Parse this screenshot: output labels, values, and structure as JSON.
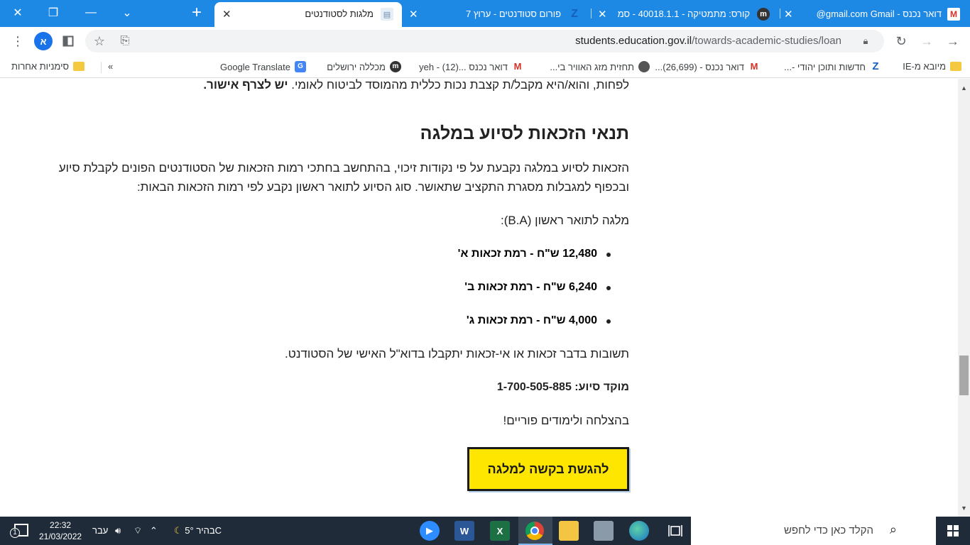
{
  "browser": {
    "tabs": [
      {
        "title": "דואר נכנס - Gmail ‏gmail.com@",
        "icon": "gmail-icon"
      },
      {
        "title": "קורס: מתמטיקה - 40018.1.1 - סמ",
        "icon": "moodle-icon"
      },
      {
        "title": "פורום סטודנטים - ערוץ 7",
        "icon": "arutz7-icon"
      },
      {
        "title": "מלגות לסטודנטים",
        "icon": "page-icon"
      }
    ],
    "new_tab": "+",
    "url_host": "students.education.gov.il",
    "url_path": "/towards-academic-studies/loan",
    "profile_initial": "א"
  },
  "bookmarks": {
    "items": [
      {
        "label": "מיובא מ-IE",
        "icon": "folder-icon"
      },
      {
        "label": "חדשות ותוכן יהודי -...",
        "icon": "arutz7-icon"
      },
      {
        "label": "דואר נכנס - (26,699)...",
        "icon": "gmail-icon"
      },
      {
        "label": "תחזית מזג האוויר בי...",
        "icon": "globe-icon"
      },
      {
        "label": "דואר נכנס ...yeh - (12)",
        "icon": "gmail-icon"
      },
      {
        "label": "מכללה ירושלים",
        "icon": "moodle-icon"
      },
      {
        "label": "Google Translate",
        "icon": "translate-icon"
      }
    ],
    "more": "»",
    "other": "סימניות אחרות"
  },
  "page": {
    "top_fragment": "לפחות, והוא/היא מקבל/ת קצבת נכות כללית מהמוסד לביטוח לאומי.",
    "top_fragment_bold": "יש לצרף אישור.",
    "heading": "תנאי הזכאות לסיוע במלגה",
    "intro_line1": "הזכאות לסיוע במלגה נקבעת על פי נקודות זיכוי, בהתחשב בחתכי רמות הזכאות של הסטודנטים הפונים לקבלת סיוע",
    "intro_line2": "ובכפוף למגבלות מסגרת התקציב שתאושר. סוג הסיוע לתואר ראשון נקבע לפי רמות הזכאות הבאות:",
    "ba_label": "מלגה לתואר ראשון (B.A):",
    "levels": [
      "12,480 ש\"ח - רמת זכאות א'",
      "6,240 ש\"ח - רמת זכאות ב'",
      "4,000 ש\"ח - רמת זכאות ג'"
    ],
    "answers_note": "תשובות בדבר זכאות או אי-זכאות יתקבלו בדוא\"ל האישי של הסטודנט.",
    "support_line": "מוקד סיוע: 1-700-505-885",
    "good_luck": "בהצלחה ולימודים פוריים!",
    "apply_button": "להגשת בקשה למלגה"
  },
  "taskbar": {
    "search_placeholder": "הקלד כאן כדי לחפש",
    "weather": "בהיר  5°C",
    "language": "עבר",
    "time": "22:32",
    "date": "21/03/2022",
    "notification_count": "1"
  },
  "colors": {
    "tab_bar": "#1e88e5",
    "apply_button_bg": "#ffe600",
    "taskbar": "#1f2b38"
  }
}
